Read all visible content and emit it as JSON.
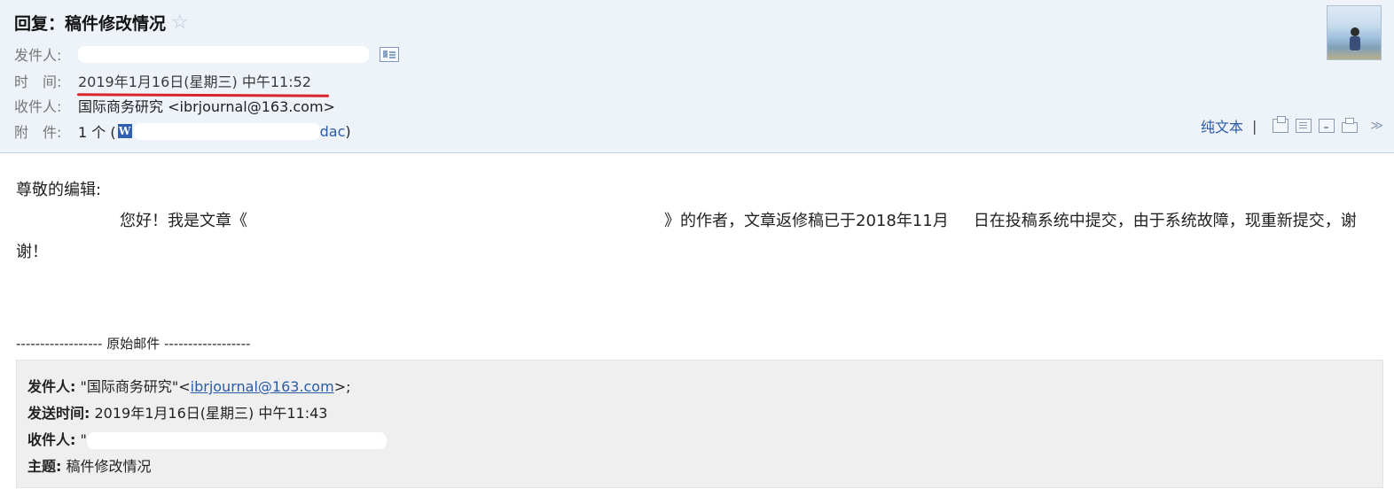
{
  "header": {
    "subject": "回复：稿件修改情况",
    "star_icon": "☆",
    "sender_label": "发件人:",
    "time_label": "时　间:",
    "time_value": "2019年1月16日(星期三) 中午11:52",
    "recipient_label": "收件人:",
    "recipient_value": "国际商务研究 <ibrjournal@163.com>",
    "attachment_label": "附　件:",
    "attachment_count": "1 个 (",
    "attachment_icon_text": "W",
    "attachment_name": "dac",
    "attachment_close": ")",
    "toolbar": {
      "plain_text": "纯文本",
      "separator": "|",
      "chevron": "≫"
    }
  },
  "body": {
    "greeting": "尊敬的编辑:",
    "para_start": "您好！我是文章《",
    "para_mid": "》的作者，文章返修稿已于2018年11月",
    "para_end": "日在投稿系统中提交，由于系统故障，现重新提交，谢谢！",
    "divider": "------------------ 原始邮件 ------------------"
  },
  "original": {
    "from_label": "发件人:",
    "from_prefix": "\"国际商务研究\"<",
    "from_email": "ibrjournal@163.com",
    "from_suffix": ">;",
    "sent_label": "发送时间:",
    "sent_value": "2019年1月16日(星期三) 中午11:43",
    "to_label": "收件人:",
    "to_prefix": "\"",
    "subject_label": "主题:",
    "subject_value": "稿件修改情况"
  },
  "colors": {
    "header_bg": "#eef3fa",
    "link": "#2a5ba6",
    "annotation_red": "#d8232a",
    "quote_bg": "#efefef"
  },
  "icons": [
    "star-icon",
    "contact-card-icon",
    "word-doc-icon",
    "avatar",
    "new-window-icon",
    "view-source-icon",
    "download-icon",
    "print-icon",
    "chevron-down-icon"
  ]
}
